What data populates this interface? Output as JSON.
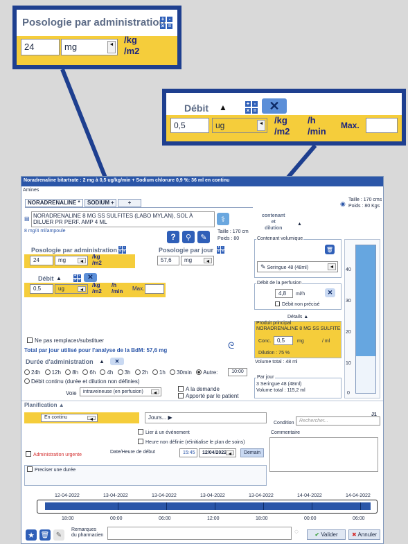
{
  "callout1": {
    "title": "Posologie par administration",
    "value": "24",
    "unit_select": "mg",
    "unit_line1": "/kg",
    "unit_line2": "/m2"
  },
  "callout2": {
    "title": "Débit",
    "sort_arrow": "▲",
    "value": "0,5",
    "unit_select": "ug",
    "unit_a1": "/kg",
    "unit_a2": "/m2",
    "unit_b1": "/h",
    "unit_b2": "/min",
    "max_label": "Max."
  },
  "window": {
    "title": "Noradrenaline bitartrate : 2 mg à 0,5 ug/kg/min + Sodium chlorure 0,9 %: 36 ml  en continu",
    "section_amines": "Amines",
    "tabs": [
      "NORADRENALINE *",
      "SODIUM",
      "+",
      "+"
    ],
    "taille": "Taille : 170 cms",
    "poids": "Poids : 80 Kgs",
    "product_name": "NORADRENALINE 8 MG SS SULFITES (LABO MYLAN), SOL À DILUER PR PERF. AMP 4 ML",
    "product_conc": "8 mg/4 ml/ampoule",
    "taille_small": "Taille : 170 cm",
    "poids_small": "Poids : 80",
    "pos_admin_label": "Posologie par administration",
    "pos_admin_value": "24",
    "pos_admin_unit": "mg",
    "pos_admin_u1": "/kg",
    "pos_admin_u2": "/m2",
    "pos_jour_label": "Posologie par jour",
    "pos_jour_value": "57,6",
    "pos_jour_unit": "mg",
    "debit_label": "Débit",
    "debit_value": "0,5",
    "debit_unit": "ug",
    "debit_u1": "/kg",
    "debit_u2": "/m2",
    "debit_u3": "/h",
    "debit_u4": "/min",
    "debit_max": "Max.",
    "ne_pas_remplacer": "Ne pas remplacer/substituer",
    "total_jour": "Total par jour utilisé pour l'analyse de la BdM: 57,6 mg",
    "contenant_title": "contenant\net\ndilution",
    "contenant_volumique": "Contenant volumique",
    "seringue": "Seringue 48 (48ml)",
    "debit_perf": "Débit de la perfusion",
    "debit_perf_value": "4,8",
    "debit_perf_unit": "ml/h",
    "debit_non_precise": "Débit non précisé",
    "details": "Détails",
    "produit_principal": "Produit principal",
    "produit_principal_name": "NORADRENALINE 8 MG SS SULFITE",
    "conc_label": "Conc.",
    "conc_value": "0,5",
    "conc_unit": "mg",
    "conc_per": "/ ml",
    "dilution": "Dilution : 75 %",
    "volume_total": "Volume total : 48 ml",
    "par_jour": "Par jour",
    "par_jour_1": "3 Seringue 48 (48ml)",
    "par_jour_2": "Volume total : 115,2 ml",
    "gauge_ticks": [
      "40",
      "30",
      "20",
      "10",
      "0"
    ],
    "gauge_fill": 0.25,
    "duree_label": "Durée d'administration",
    "duree_options": [
      "24h",
      "12h",
      "8h",
      "6h",
      "4h",
      "3h",
      "2h",
      "1h",
      "30min",
      "Autre:"
    ],
    "duree_autre_value": "10:00",
    "debit_continu": "Débit continu (durée et dilution non définies)",
    "voie_label": "Voie",
    "voie_value": "intraveineuse (en perfusion)",
    "a_la_demande": "A la demande",
    "apporte_patient": "Apporté par le patient",
    "planification": "Planification",
    "en_continu": "En continu",
    "jours": "Jours...",
    "j1": "J1",
    "condition_label": "Condition",
    "condition_placeholder": "Rechercher...",
    "lier_evenement": "Lier à un événement",
    "heure_non_definie": "Heure non définie (réinitialise le plan de soins)",
    "commentaire": "Commentaire",
    "admin_urgente": "Administration urgente",
    "date_debut_label": "Date/Heure de début",
    "start_time": "15:45",
    "start_date": "12/04/2022",
    "demain": "Demain",
    "preciser_duree": "Preciser une durée",
    "timeline_dates": [
      "12-04-2022",
      "13-04-2022",
      "13-04-2022",
      "13-04-2022",
      "13-04-2022",
      "14-04-2022",
      "14-04-2022"
    ],
    "timeline_hours": [
      "18:00",
      "00:00",
      "06:00",
      "12:00",
      "18:00",
      "00:00",
      "06:00"
    ],
    "remarques": "Remarques\ndu pharmacien",
    "valider": "Valider",
    "annuler": "Annuler"
  }
}
